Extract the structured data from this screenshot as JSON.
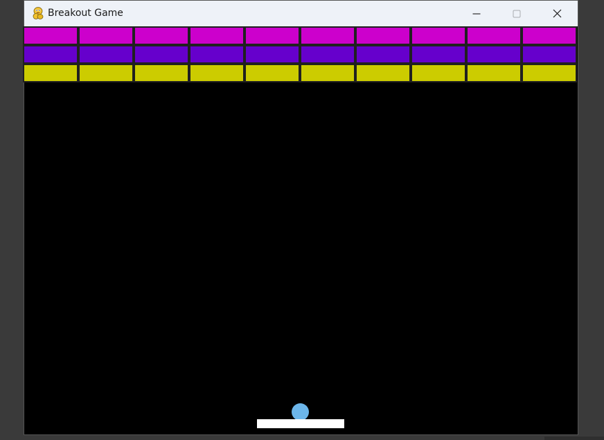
{
  "window": {
    "title": "Breakout Game",
    "app_icon": "pygame-snake-icon",
    "controls": {
      "minimize_icon": "minimize-icon",
      "maximize_icon": "maximize-icon",
      "close_icon": "close-icon"
    }
  },
  "game": {
    "background_color": "#000000",
    "brick_rows": [
      {
        "color": "#cc00cc",
        "bricks": 10
      },
      {
        "color": "#6600cc",
        "bricks": 10
      },
      {
        "color": "#cccc00",
        "bricks": 10
      }
    ],
    "brick_border_color": "#202020",
    "paddle_color": "#ffffff",
    "ball_color": "#6cb6ea"
  }
}
